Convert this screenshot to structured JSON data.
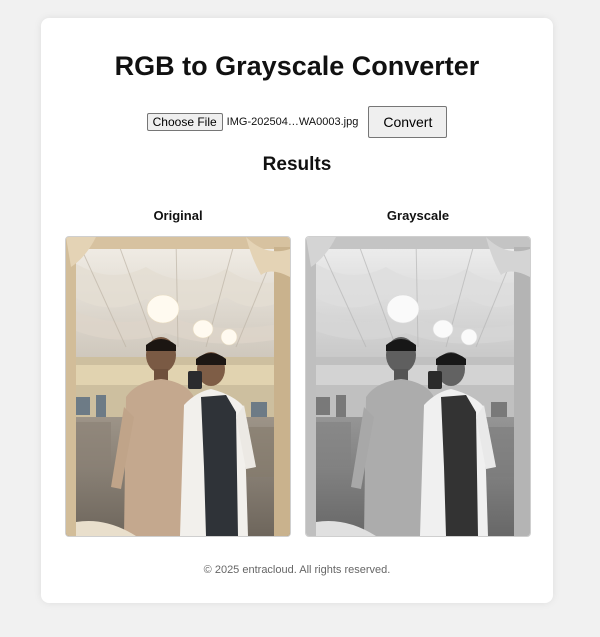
{
  "page": {
    "title": "RGB to Grayscale Converter",
    "results_heading": "Results",
    "footer": "© 2025 entracloud. All rights reserved."
  },
  "upload": {
    "choose_label": "Choose File",
    "file_name": "IMG-202504…WA0003.jpg",
    "convert_label": "Convert"
  },
  "results": {
    "original_label": "Original",
    "grayscale_label": "Grayscale"
  },
  "colors": {
    "background": "#f1f1f1",
    "card": "#ffffff",
    "footer_text": "#666666"
  }
}
